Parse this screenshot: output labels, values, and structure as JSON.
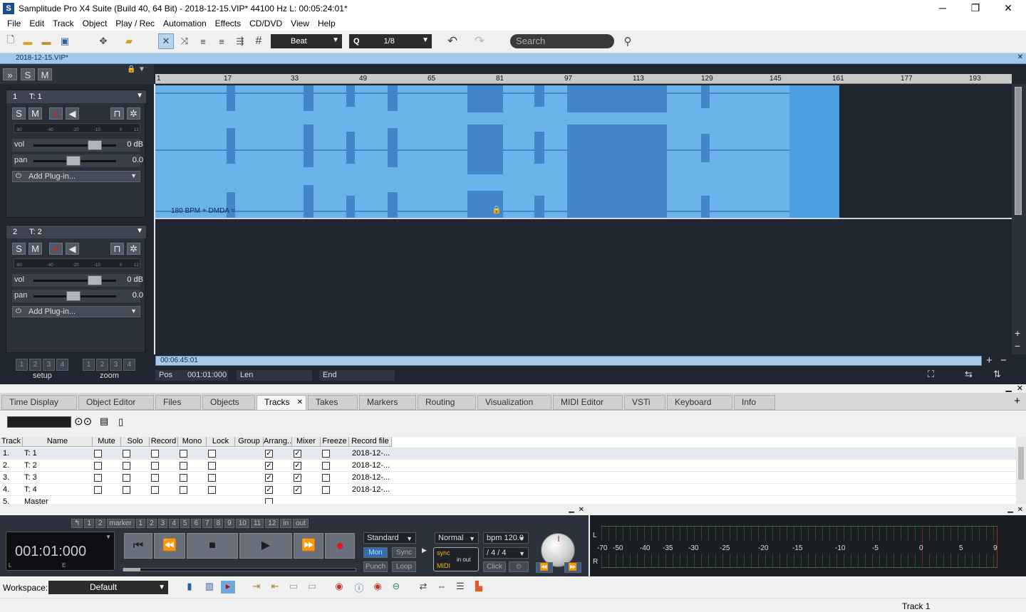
{
  "window": {
    "title": "Samplitude Pro X4 Suite (Build 40, 64 Bit)  -  2018-12-15.VIP*   44100 Hz L: 00:05:24:01*",
    "app_icon": "S",
    "minimize": "─",
    "maximize": "❐",
    "close": "✕"
  },
  "menu": [
    "File",
    "Edit",
    "Track",
    "Object",
    "Play / Rec",
    "Automation",
    "Effects",
    "CD/DVD",
    "View",
    "Help"
  ],
  "toolbar": {
    "snap_mode": "Beat",
    "quantize_label": "Q",
    "quantize_value": "1/8",
    "search_placeholder": "Search"
  },
  "project_tab": "2018-12-15.VIP*",
  "arranger": {
    "head_buttons": [
      "»",
      "S",
      "M"
    ],
    "ruler": [
      "1",
      "17",
      "33",
      "49",
      "65",
      "81",
      "97",
      "113",
      "129",
      "145",
      "161",
      "177",
      "193"
    ],
    "clip_label": "180 BPM + DMDA =",
    "position_bar": "00:06:45:01",
    "pos_label": "Pos",
    "pos_value": "001:01:000",
    "len_label": "Len",
    "end_label": "End",
    "setup_label": "setup",
    "zoom_label": "zoom",
    "setup_buttons": [
      "1",
      "2",
      "3",
      "4"
    ],
    "zoom_buttons": [
      "1",
      "2",
      "3",
      "4"
    ]
  },
  "tracks": [
    {
      "num": "1",
      "name": "T: 1",
      "solo": "S",
      "mute": "M",
      "vol_label": "vol",
      "vol_value": "0 dB",
      "pan_label": "pan",
      "pan_value": "0.0",
      "plugin": "Add Plug-in...",
      "meter_scale": [
        "-80",
        "-40",
        "-20",
        "-10",
        "0",
        "12"
      ]
    },
    {
      "num": "2",
      "name": "T: 2",
      "solo": "S",
      "mute": "M",
      "vol_label": "vol",
      "vol_value": "0 dB",
      "pan_label": "pan",
      "pan_value": "0.0",
      "plugin": "Add Plug-in...",
      "meter_scale": [
        "-80",
        "-40",
        "-20",
        "-10",
        "0",
        "12"
      ]
    }
  ],
  "dock_tabs": [
    "Time Display",
    "Object Editor",
    "Files",
    "Objects",
    "Tracks",
    "Takes",
    "Markers",
    "Routing",
    "Visualization",
    "MIDI Editor",
    "VSTi",
    "Keyboard",
    "Info"
  ],
  "active_tab": "Tracks",
  "track_table": {
    "columns": [
      "Track",
      "Name",
      "Mute",
      "Solo",
      "Record",
      "Mono",
      "Lock",
      "Group",
      "Arrang...",
      "Mixer",
      "Freeze",
      "Record file"
    ],
    "rows": [
      {
        "track": "1.",
        "name": "T: 1",
        "arrange": true,
        "mixer": true,
        "file": "2018-12-..."
      },
      {
        "track": "2.",
        "name": "T: 2",
        "arrange": true,
        "mixer": true,
        "file": "2018-12-..."
      },
      {
        "track": "3.",
        "name": "T: 3",
        "arrange": true,
        "mixer": true,
        "file": "2018-12-..."
      },
      {
        "track": "4.",
        "name": "T: 4",
        "arrange": true,
        "mixer": true,
        "file": "2018-12-..."
      },
      {
        "track": "5.",
        "name": "Master",
        "arrange": false,
        "mixer": false,
        "file": ""
      }
    ]
  },
  "transport": {
    "time": "001:01:000",
    "time_l": "L",
    "time_e": "E",
    "marker_left": [
      "↰",
      "1",
      "2"
    ],
    "marker_label": "marker",
    "marker_numbers": [
      "1",
      "2",
      "3",
      "4",
      "5",
      "6",
      "7",
      "8",
      "9",
      "10",
      "11",
      "12"
    ],
    "in_label": "in",
    "out_label": "out",
    "mode": "Standard",
    "mon": "Mon",
    "sync": "Sync",
    "punch": "Punch",
    "loop": "Loop",
    "normal": "Normal",
    "bpm": "bpm 120.0",
    "signature": "/   4 / 4",
    "sync_box": "sync",
    "midi_box": "MIDI",
    "in_out": "in  out",
    "click": "Click",
    "buttons": {
      "rewind_start": "⏮",
      "rewind": "⏪",
      "stop": "■",
      "play": "▶",
      "forward": "⏩",
      "record": "●"
    }
  },
  "meters": {
    "scale": [
      "-70",
      "-50",
      "-40",
      "-35",
      "-30",
      "-25",
      "-20",
      "-15",
      "-10",
      "-5",
      "0",
      "5",
      "9"
    ],
    "l": "L",
    "r": "R"
  },
  "workspace": {
    "label": "Workspace:",
    "value": "Default"
  },
  "status": "Track 1"
}
